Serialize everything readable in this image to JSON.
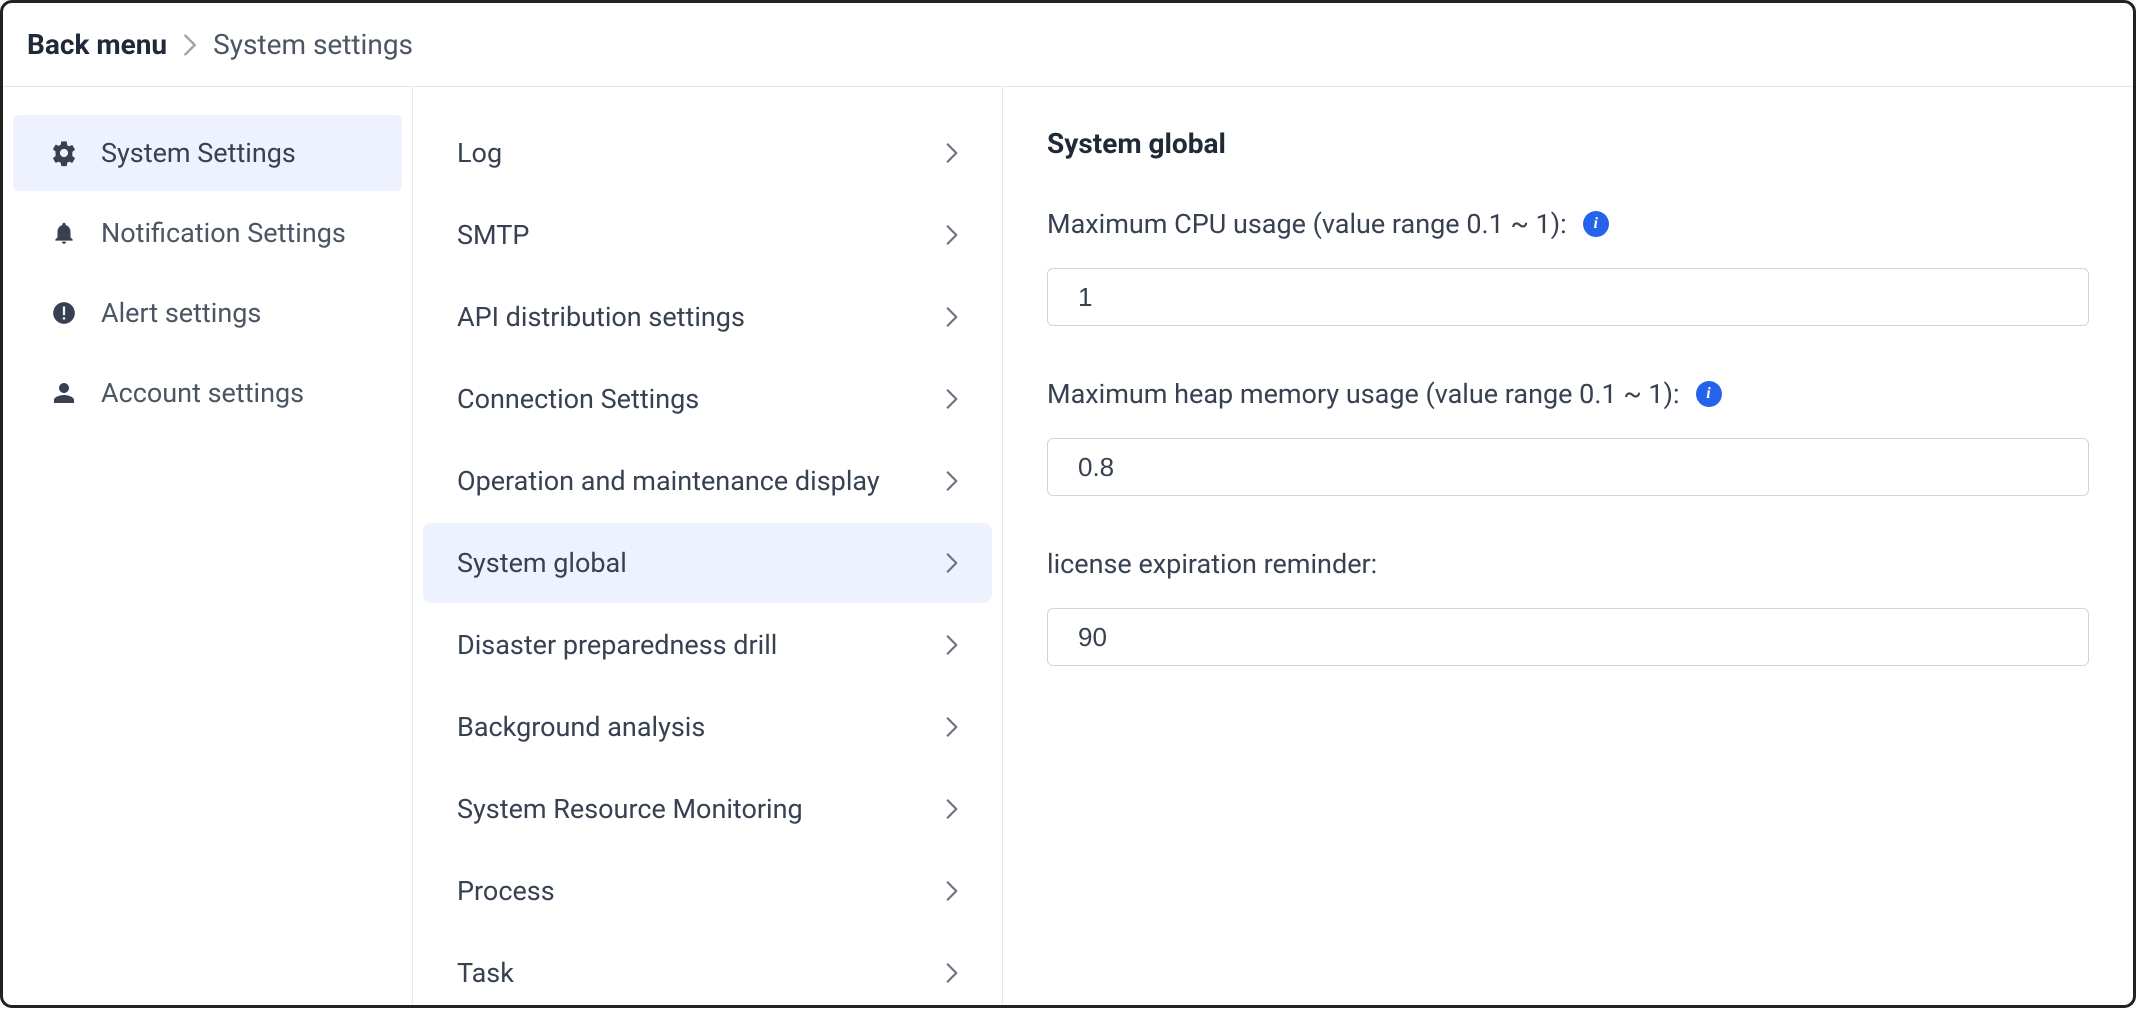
{
  "breadcrumb": {
    "back": "Back menu",
    "current": "System settings"
  },
  "primaryNav": {
    "items": [
      {
        "label": "System Settings",
        "icon": "gear",
        "active": true
      },
      {
        "label": "Notification Settings",
        "icon": "bell",
        "active": false
      },
      {
        "label": "Alert settings",
        "icon": "alert",
        "active": false
      },
      {
        "label": "Account settings",
        "icon": "user",
        "active": false
      }
    ]
  },
  "secondaryNav": {
    "items": [
      {
        "label": "Log",
        "active": false
      },
      {
        "label": "SMTP",
        "active": false
      },
      {
        "label": "API distribution settings",
        "active": false
      },
      {
        "label": "Connection Settings",
        "active": false
      },
      {
        "label": "Operation and maintenance display",
        "active": false
      },
      {
        "label": "System global",
        "active": true
      },
      {
        "label": "Disaster preparedness drill",
        "active": false
      },
      {
        "label": "Background analysis",
        "active": false
      },
      {
        "label": "System Resource Monitoring",
        "active": false
      },
      {
        "label": "Process",
        "active": false
      },
      {
        "label": "Task",
        "active": false
      }
    ]
  },
  "content": {
    "title": "System global",
    "fields": [
      {
        "label": "Maximum CPU usage (value range 0.1 ~ 1):",
        "value": "1",
        "hasInfo": true
      },
      {
        "label": "Maximum heap memory usage (value range 0.1 ~ 1):",
        "value": "0.8",
        "hasInfo": true
      },
      {
        "label": "license expiration reminder:",
        "value": "90",
        "hasInfo": false
      }
    ]
  }
}
